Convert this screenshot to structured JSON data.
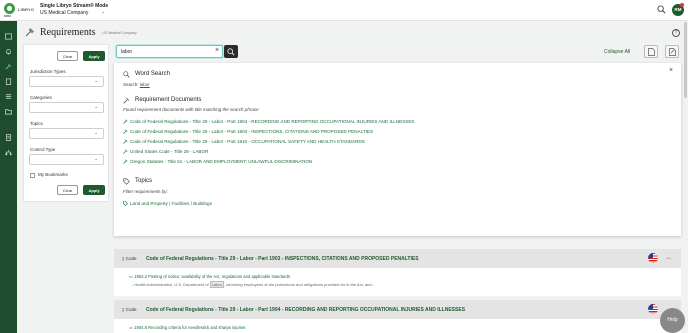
{
  "app": {
    "logo_text": "LIBRYO",
    "logo_sub": "ERM",
    "mode": "Single Libryo Stream® Mode",
    "company": "US Medical Company",
    "avatar_initials": "RM"
  },
  "page": {
    "title": "Requirements",
    "subtitle": "US Medical Company",
    "help": "?"
  },
  "filters": {
    "clear_label": "Clear",
    "apply_label": "Apply",
    "fields": [
      "Jurisdiction Types",
      "Categories",
      "Topics",
      "Control Type"
    ],
    "bookmarks_label": "My Bookmarks"
  },
  "search": {
    "value": "labor",
    "clear": "×",
    "collapse_all": "Collapse All"
  },
  "dropdown": {
    "word_search_title": "Word Search",
    "search_prefix": "Search:",
    "search_term": "labor",
    "req_docs_title": "Requirement Documents",
    "req_docs_desc": "Found requirement documents with title matching the search phrase",
    "results": [
      "Code of Federal Regulations - Title 29 - Labor - Part 1904 - RECORDING AND REPORTING OCCUPATIONAL INJURIES AND ILLNESSES",
      "Code of Federal Regulations - Title 29 - Labor - Part 1903 - INSPECTIONS, CITATIONS AND PROPOSED PENALTIES",
      "Code of Federal Regulations - Title 29 - Labor - Part 1910 - OCCUPATIONAL SAFETY AND HEALTH STANDARDS",
      "United States Code - Title 29 - LABOR",
      "Oregon Statutes - Title 51 - LABOR AND EMPLOYMENT; UNLAWFUL DISCRIMINATION"
    ],
    "topics_title": "Topics",
    "topics_desc": "Filter requirements by:",
    "topic_link": "Land and Property | Facilities / Buildings",
    "close": "×"
  },
  "cards": [
    {
      "code_label": "Code",
      "title": "Code of Federal Regulations - Title 29 - Labor - Part 1903 - INSPECTIONS, CITATIONS AND PROPOSED PENALTIES",
      "sub_title": "1903.2 Posting of notice; availability of the Act, regulations and applicable standards",
      "snippet_before": "...Health Administration, U.S. Department of",
      "snippet_hl": "Labor",
      "snippet_after": ", informing employees of the protections and obligations provided for in the Act, and..."
    },
    {
      "code_label": "Code",
      "title": "Code of Federal Regulations - Title 29 - Labor - Part 1904 - RECORDING AND REPORTING OCCUPATIONAL INJURIES AND ILLNESSES",
      "sub_title": "1904.8 Recording criteria for needlestick and sharps injuries"
    }
  ],
  "help_fab": "Help",
  "colors": {
    "brand": "#1e5a2e",
    "accent": "#6cc8c2",
    "link": "#1e6a3a"
  }
}
